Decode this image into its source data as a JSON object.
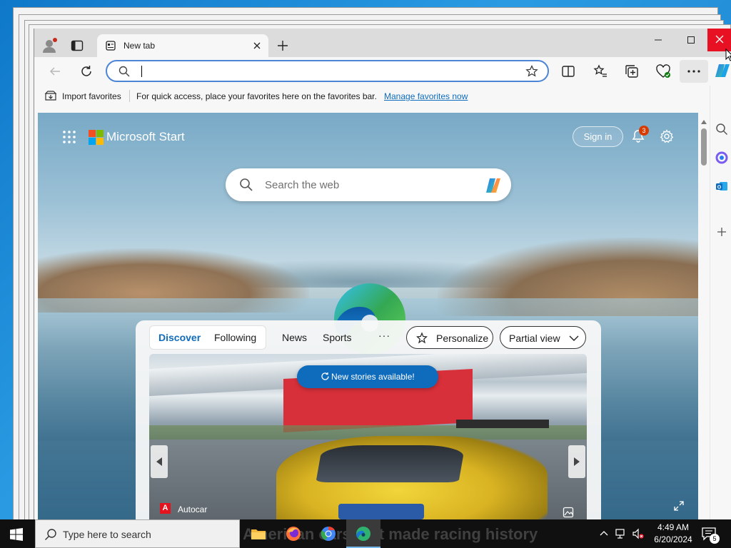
{
  "browser": {
    "tab_title": "New tab",
    "favorites_bar": {
      "import_label": "Import favorites",
      "hint": "For quick access, place your favorites here on the favorites bar.",
      "manage_link": "Manage favorites now"
    }
  },
  "newtab": {
    "brand": "Microsoft Start",
    "sign_in": "Sign in",
    "notification_count": "3",
    "search_placeholder": "Search the web",
    "feed": {
      "pivots": [
        "Discover",
        "Following",
        "News",
        "Sports"
      ],
      "more": "···",
      "personalize": "Personalize",
      "view_mode": "Partial view",
      "new_stories": "New stories available!",
      "source_logo": "A",
      "source_name": "Autocar"
    }
  },
  "taskbar": {
    "search_placeholder": "Type here to search",
    "headline": "American cars that made racing history",
    "time": "4:49 AM",
    "date": "6/20/2024",
    "notification_count": "5"
  },
  "colors": {
    "accent": "#0f6cbd",
    "close": "#e81123",
    "badge": "#d83b01"
  }
}
